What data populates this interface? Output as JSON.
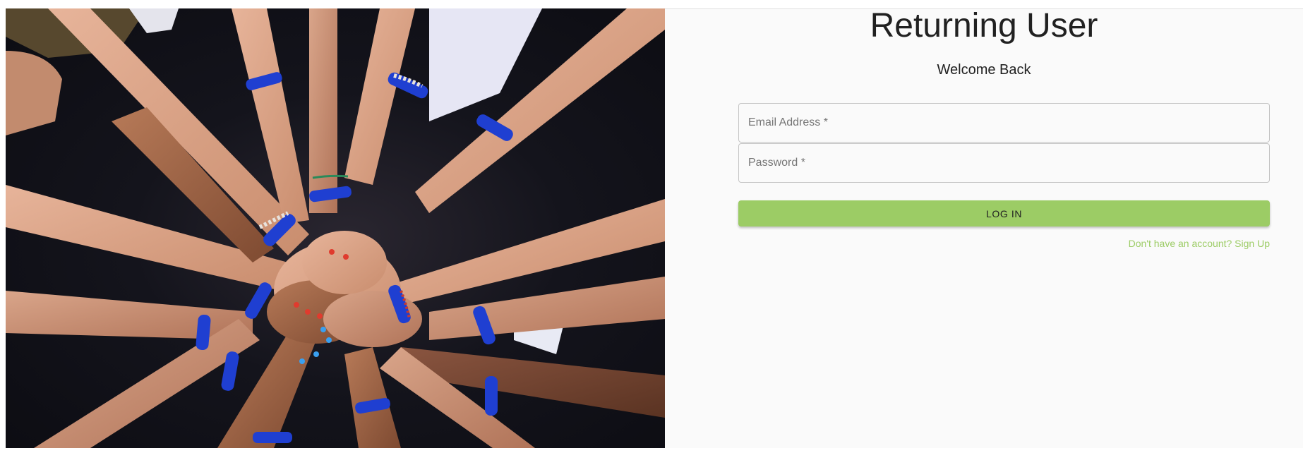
{
  "image": {
    "subject": "hands stacked together with blue wristbands"
  },
  "login": {
    "title": "Returning User",
    "subtitle": "Welcome Back",
    "email_placeholder": "Email Address *",
    "password_placeholder": "Password *",
    "login_button": "LOG IN",
    "signup_link": "Don't have an account? Sign Up"
  },
  "colors": {
    "accent": "#9ccc65",
    "background": "#fafafa",
    "text": "#212121",
    "wristband": "#1f3fd1"
  }
}
